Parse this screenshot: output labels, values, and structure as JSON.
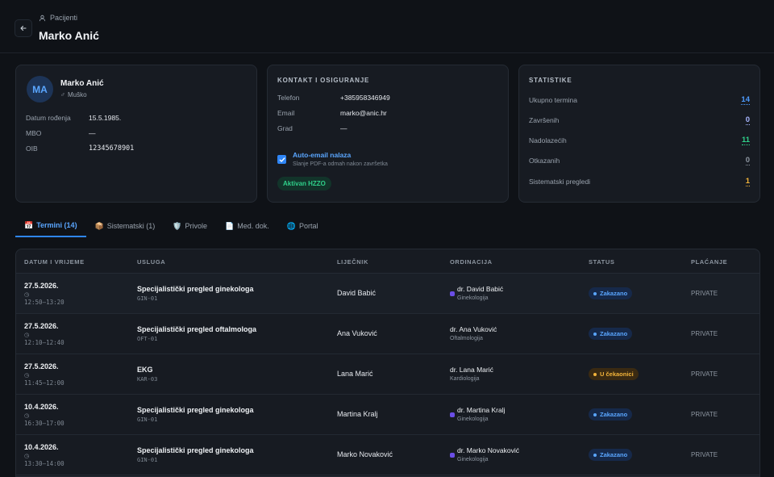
{
  "header": {
    "breadcrumb": "Pacijenti",
    "title": "Marko Anić"
  },
  "patient": {
    "initials": "MA",
    "name": "Marko Anić",
    "gender": "Muško",
    "fields": [
      {
        "label": "Datum rođenja",
        "value": "15.5.1985."
      },
      {
        "label": "MBO",
        "value": "—"
      },
      {
        "label": "OIB",
        "value": "12345678901"
      }
    ]
  },
  "contact": {
    "heading": "KONTAKT I OSIGURANJE",
    "fields": [
      {
        "label": "Telefon",
        "value": "+385958346949"
      },
      {
        "label": "Email",
        "value": "marko@anic.hr"
      },
      {
        "label": "Grad",
        "value": "—"
      }
    ],
    "auto_email_label": "Auto-email nalaza",
    "auto_email_sub": "Slanje PDF-a odmah nakon završetka",
    "auto_email_checked": true,
    "hzzo_badge": "Aktivan HZZO"
  },
  "stats": {
    "heading": "STATISTIKE",
    "items": [
      {
        "label": "Ukupno termina",
        "value": "14",
        "color": "#4d9bff"
      },
      {
        "label": "Završenih",
        "value": "0",
        "color": "#a7b6ff"
      },
      {
        "label": "Nadolazećih",
        "value": "11",
        "color": "#2fd08a"
      },
      {
        "label": "Otkazanih",
        "value": "0",
        "color": "#8d96a1"
      },
      {
        "label": "Sistematski pregledi",
        "value": "1",
        "color": "#f2b33a"
      }
    ]
  },
  "tabs": [
    {
      "icon": "📅",
      "label": "Termini (14)",
      "active": true
    },
    {
      "icon": "📦",
      "label": "Sistematski (1)"
    },
    {
      "icon": "🛡️",
      "label": "Privole"
    },
    {
      "icon": "📄",
      "label": "Med. dok."
    },
    {
      "icon": "🌐",
      "label": "Portal"
    }
  ],
  "table": {
    "headers": [
      "DATUM I VRIJEME",
      "USLUGA",
      "LIJEČNIK",
      "ORDINACIJA",
      "STATUS",
      "PLAĆANJE"
    ],
    "rows": [
      {
        "date": "27.5.2026.",
        "time": "12:50–13:20",
        "service": "Specijalistički pregled ginekologa",
        "code": "GIN-01",
        "doctor": "David Babić",
        "ord_name": "dr. David Babić",
        "ord_spec": "Ginekologija",
        "ord_dot": true,
        "status": "Zakazano",
        "payment": "PRIVATE"
      },
      {
        "date": "27.5.2026.",
        "time": "12:10–12:40",
        "service": "Specijalistički pregled oftalmologa",
        "code": "OFT-01",
        "doctor": "Ana Vuković",
        "ord_name": "dr. Ana Vuković",
        "ord_spec": "Oftalmologija",
        "ord_dot": false,
        "status": "Zakazano",
        "payment": "PRIVATE"
      },
      {
        "date": "27.5.2026.",
        "time": "11:45–12:00",
        "service": "EKG",
        "code": "KAR-03",
        "doctor": "Lana Marić",
        "ord_name": "dr. Lana Marić",
        "ord_spec": "Kardiologija",
        "ord_dot": false,
        "status": "U čekaonici",
        "payment": "PRIVATE"
      },
      {
        "date": "10.4.2026.",
        "time": "16:30–17:00",
        "service": "Specijalistički pregled ginekologa",
        "code": "GIN-01",
        "doctor": "Martina Kralj",
        "ord_name": "dr. Martina Kralj",
        "ord_spec": "Ginekologija",
        "ord_dot": true,
        "status": "Zakazano",
        "payment": "PRIVATE"
      },
      {
        "date": "10.4.2026.",
        "time": "13:30–14:00",
        "service": "Specijalistički pregled ginekologa",
        "code": "GIN-01",
        "doctor": "Marko Novaković",
        "ord_name": "dr. Marko Novaković",
        "ord_spec": "Ginekologija",
        "ord_dot": true,
        "status": "Zakazano",
        "payment": "PRIVATE"
      }
    ]
  },
  "colors": {
    "accent": "#2f86f6",
    "status_scheduled_bg": "#16294a",
    "status_scheduled_fg": "#5aa6ff",
    "status_waiting_bg": "#3a2a12",
    "status_waiting_fg": "#f2b33a"
  }
}
